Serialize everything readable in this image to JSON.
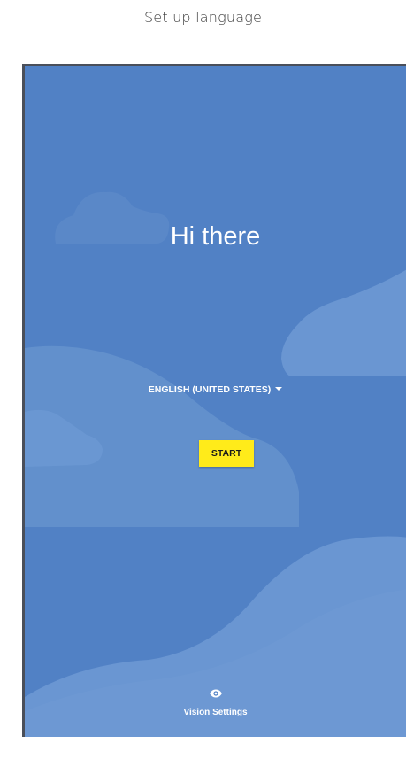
{
  "page": {
    "caption": "Set up language"
  },
  "setup": {
    "greeting": "Hi there",
    "language": "ENGLISH (UNITED STATES)",
    "start_label": "START",
    "vision_label": "Vision Settings"
  },
  "colors": {
    "background": "#5181c5",
    "start_button": "#ffeb1a",
    "text": "#ffffff"
  },
  "icons": {
    "language_dropdown": "chevron-down-icon",
    "vision": "eye-icon"
  }
}
